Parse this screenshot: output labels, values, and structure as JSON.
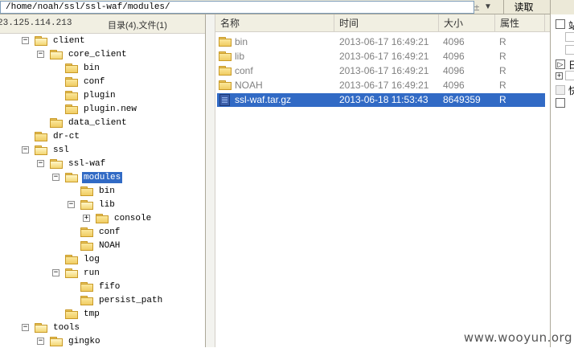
{
  "path_bar": {
    "path": "/home/noah/ssl/ssl-waf/modules/",
    "add_symbol": "±",
    "dropdown_symbol": "▼",
    "read_button": "读取"
  },
  "tree_pane": {
    "host": "23.125.114.213",
    "summary": "目录(4),文件(1)",
    "items": [
      {
        "label": "client",
        "level": 1,
        "expander": "−",
        "open": true
      },
      {
        "label": "core_client",
        "level": 2,
        "expander": "−",
        "open": true
      },
      {
        "label": "bin",
        "level": 3,
        "expander": "",
        "open": false
      },
      {
        "label": "conf",
        "level": 3,
        "expander": "",
        "open": false
      },
      {
        "label": "plugin",
        "level": 3,
        "expander": "",
        "open": false
      },
      {
        "label": "plugin.new",
        "level": 3,
        "expander": "",
        "open": false
      },
      {
        "label": "data_client",
        "level": 2,
        "expander": "",
        "open": false
      },
      {
        "label": "dr-ct",
        "level": 1,
        "expander": "",
        "open": false
      },
      {
        "label": "ssl",
        "level": 1,
        "expander": "−",
        "open": true
      },
      {
        "label": "ssl-waf",
        "level": 2,
        "expander": "−",
        "open": true
      },
      {
        "label": "modules",
        "level": 3,
        "expander": "−",
        "open": true,
        "selected": true
      },
      {
        "label": "bin",
        "level": 4,
        "expander": "",
        "open": false
      },
      {
        "label": "lib",
        "level": 4,
        "expander": "−",
        "open": true
      },
      {
        "label": "console",
        "level": 5,
        "expander": "+",
        "open": false
      },
      {
        "label": "conf",
        "level": 4,
        "expander": "",
        "open": false
      },
      {
        "label": "NOAH",
        "level": 4,
        "expander": "",
        "open": false
      },
      {
        "label": "log",
        "level": 3,
        "expander": "",
        "open": false
      },
      {
        "label": "run",
        "level": 3,
        "expander": "−",
        "open": true
      },
      {
        "label": "fifo",
        "level": 4,
        "expander": "",
        "open": false
      },
      {
        "label": "persist_path",
        "level": 4,
        "expander": "",
        "open": false
      },
      {
        "label": "tmp",
        "level": 3,
        "expander": "",
        "open": false
      },
      {
        "label": "tools",
        "level": 1,
        "expander": "−",
        "open": true
      },
      {
        "label": "gingko",
        "level": 2,
        "expander": "−",
        "open": true
      }
    ]
  },
  "list_pane": {
    "columns": {
      "name": "名称",
      "time": "时间",
      "size": "大小",
      "attr": "属性"
    },
    "rows": [
      {
        "name": "bin",
        "time": "2013-06-17 16:49:21",
        "size": "4096",
        "attr": "R",
        "type": "folder"
      },
      {
        "name": "lib",
        "time": "2013-06-17 16:49:21",
        "size": "4096",
        "attr": "R",
        "type": "folder"
      },
      {
        "name": "conf",
        "time": "2013-06-17 16:49:21",
        "size": "4096",
        "attr": "R",
        "type": "folder"
      },
      {
        "name": "NOAH",
        "time": "2013-06-17 16:49:21",
        "size": "4096",
        "attr": "R",
        "type": "folder"
      },
      {
        "name": "ssl-waf.tar.gz",
        "time": "2013-06-18 11:53:43",
        "size": "8649359",
        "attr": "R",
        "type": "file",
        "selected": true
      }
    ]
  },
  "side_panel": {
    "glyph_1": "站",
    "glyph_2": "日",
    "glyph_3": "快"
  },
  "watermark": "www.wooyun.org",
  "colors": {
    "selection": "#316ac5",
    "folder": "#f0cc62",
    "chrome": "#ece9d8"
  }
}
